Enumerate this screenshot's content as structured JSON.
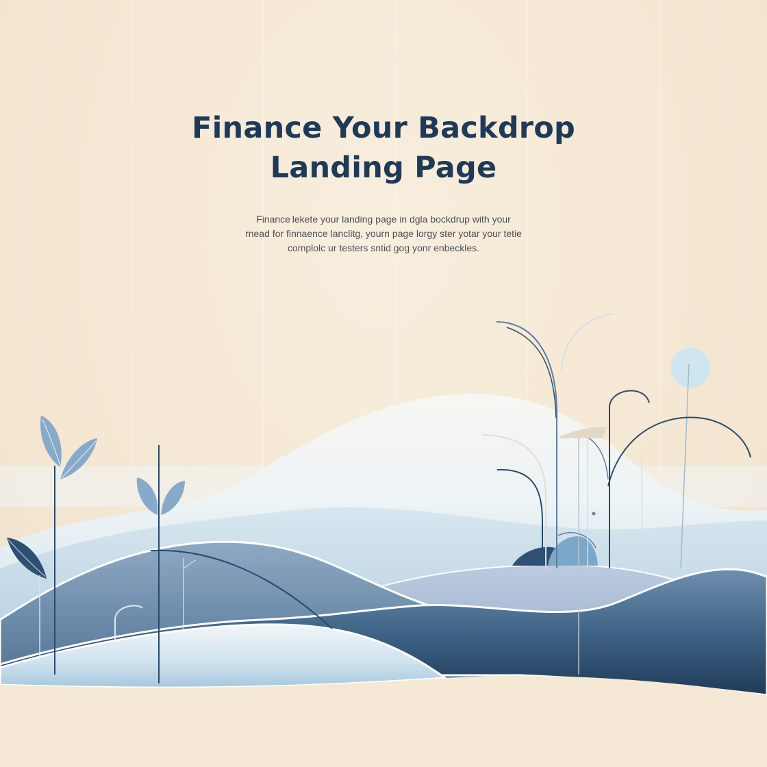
{
  "hero": {
    "title_line_1": "Finance Your Backdrop",
    "title_line_2": "Landing Page",
    "body_lines": [
      "Finance lekete your landing page in dgla bockdrup with your",
      "rnead for finnaence lanclitg, yourn page lorgy ster yotar your tetie",
      "complolc ur testers sntid gog yonr enbeckles."
    ]
  },
  "colors": {
    "background": "#f6ead7",
    "title": "#1f3a58",
    "body_text": "#4a4f57",
    "navy": "#1f3a58",
    "mid_blue": "#5a7fa3",
    "light_blue": "#bcd5e6",
    "pale_blue": "#e4eff5"
  },
  "illustration": {
    "icons": [
      "leaf-icon",
      "plant-stem-icon",
      "hill-icon",
      "sun-circle-icon",
      "arch-stem-icon"
    ]
  }
}
